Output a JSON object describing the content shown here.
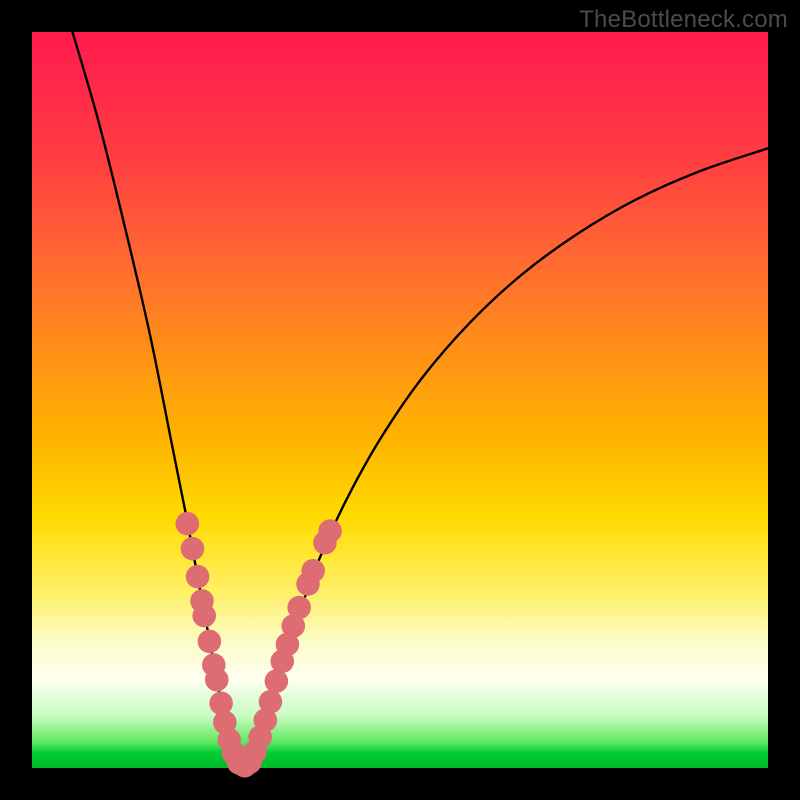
{
  "watermark": "TheBottleneck.com",
  "colors": {
    "frame": "#000000",
    "curve_stroke": "#000000",
    "dot_fill": "#de6d73",
    "gradient_top": "#ff1a4d",
    "gradient_bottom": "#00b828"
  },
  "chart_data": {
    "type": "line",
    "title": "",
    "xlabel": "",
    "ylabel": "",
    "xlim": [
      0,
      1
    ],
    "ylim": [
      0,
      1
    ],
    "note": "V-shaped bottleneck curve. x,y are normalized plot-area coordinates (0,0 = top-left, 1,1 = bottom-right). The curve descends steeply from upper-left, reaches its minimum near x≈0.28 at the bottom edge, then rises with decreasing slope toward the right edge.",
    "series": [
      {
        "name": "bottleneck-curve",
        "points": [
          {
            "x": 0.055,
            "y": 0.0
          },
          {
            "x": 0.09,
            "y": 0.12
          },
          {
            "x": 0.125,
            "y": 0.26
          },
          {
            "x": 0.16,
            "y": 0.41
          },
          {
            "x": 0.19,
            "y": 0.56
          },
          {
            "x": 0.21,
            "y": 0.66
          },
          {
            "x": 0.225,
            "y": 0.74
          },
          {
            "x": 0.24,
            "y": 0.82
          },
          {
            "x": 0.252,
            "y": 0.885
          },
          {
            "x": 0.262,
            "y": 0.935
          },
          {
            "x": 0.272,
            "y": 0.975
          },
          {
            "x": 0.282,
            "y": 0.995
          },
          {
            "x": 0.292,
            "y": 0.997
          },
          {
            "x": 0.303,
            "y": 0.98
          },
          {
            "x": 0.315,
            "y": 0.945
          },
          {
            "x": 0.33,
            "y": 0.895
          },
          {
            "x": 0.348,
            "y": 0.835
          },
          {
            "x": 0.37,
            "y": 0.77
          },
          {
            "x": 0.395,
            "y": 0.705
          },
          {
            "x": 0.43,
            "y": 0.63
          },
          {
            "x": 0.475,
            "y": 0.55
          },
          {
            "x": 0.53,
            "y": 0.47
          },
          {
            "x": 0.595,
            "y": 0.395
          },
          {
            "x": 0.665,
            "y": 0.33
          },
          {
            "x": 0.74,
            "y": 0.275
          },
          {
            "x": 0.82,
            "y": 0.228
          },
          {
            "x": 0.905,
            "y": 0.19
          },
          {
            "x": 1.0,
            "y": 0.158
          }
        ]
      }
    ],
    "dots": {
      "name": "highlight-dots",
      "note": "Pink circular markers concentrated near the V vertex on both branches.",
      "r_norm": 0.016,
      "points": [
        {
          "x": 0.211,
          "y": 0.668
        },
        {
          "x": 0.218,
          "y": 0.702
        },
        {
          "x": 0.225,
          "y": 0.74
        },
        {
          "x": 0.231,
          "y": 0.773
        },
        {
          "x": 0.234,
          "y": 0.793
        },
        {
          "x": 0.241,
          "y": 0.828
        },
        {
          "x": 0.247,
          "y": 0.86
        },
        {
          "x": 0.251,
          "y": 0.88
        },
        {
          "x": 0.257,
          "y": 0.912
        },
        {
          "x": 0.262,
          "y": 0.938
        },
        {
          "x": 0.268,
          "y": 0.962
        },
        {
          "x": 0.274,
          "y": 0.98
        },
        {
          "x": 0.281,
          "y": 0.993
        },
        {
          "x": 0.289,
          "y": 0.997
        },
        {
          "x": 0.296,
          "y": 0.992
        },
        {
          "x": 0.303,
          "y": 0.978
        },
        {
          "x": 0.31,
          "y": 0.958
        },
        {
          "x": 0.317,
          "y": 0.935
        },
        {
          "x": 0.324,
          "y": 0.91
        },
        {
          "x": 0.332,
          "y": 0.882
        },
        {
          "x": 0.34,
          "y": 0.855
        },
        {
          "x": 0.347,
          "y": 0.832
        },
        {
          "x": 0.355,
          "y": 0.807
        },
        {
          "x": 0.363,
          "y": 0.782
        },
        {
          "x": 0.375,
          "y": 0.75
        },
        {
          "x": 0.382,
          "y": 0.732
        },
        {
          "x": 0.398,
          "y": 0.694
        },
        {
          "x": 0.405,
          "y": 0.678
        }
      ]
    }
  }
}
